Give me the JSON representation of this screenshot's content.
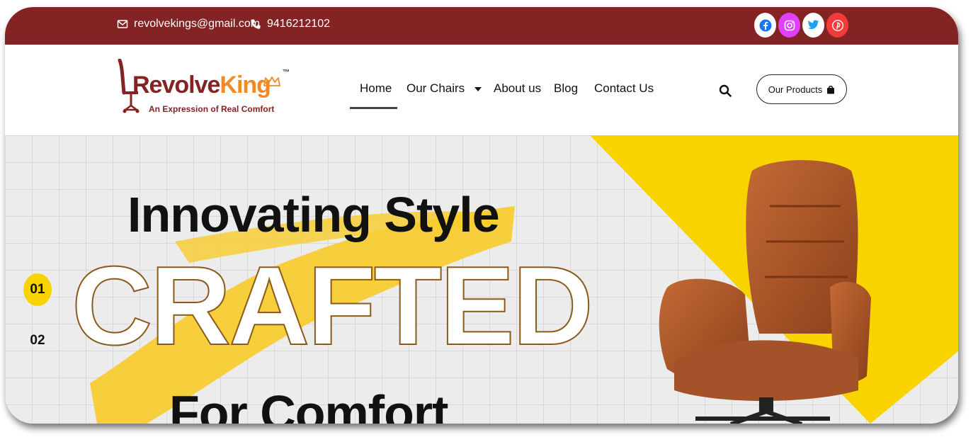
{
  "topbar": {
    "email": "revolvekings@gmail.com",
    "phone": "9416212102",
    "social": [
      {
        "name": "facebook-icon",
        "color": "#1877f2"
      },
      {
        "name": "instagram-icon",
        "color": "#e040fb"
      },
      {
        "name": "twitter-icon",
        "color": "#1da1f2"
      },
      {
        "name": "pinterest-icon",
        "color": "#e60023"
      }
    ]
  },
  "header": {
    "logo": {
      "brand_part1": "Revolve",
      "brand_part2": "King",
      "tm": "™",
      "tagline": "An Expression of Real Comfort"
    },
    "nav": [
      {
        "label": "Home",
        "active": true
      },
      {
        "label": "Our Chairs",
        "has_dropdown": true
      },
      {
        "label": "About us"
      },
      {
        "label": "Blog"
      },
      {
        "label": "Contact Us"
      }
    ],
    "products_button": "Our Products"
  },
  "hero": {
    "slides": [
      "01",
      "02"
    ],
    "active_slide": "01",
    "line1": "Innovating Style",
    "line2": "CRAFTED",
    "line3": "For Comfort"
  },
  "colors": {
    "brand_dark_red": "#842323",
    "brand_orange": "#f08a24",
    "accent_yellow": "#f9d300"
  }
}
